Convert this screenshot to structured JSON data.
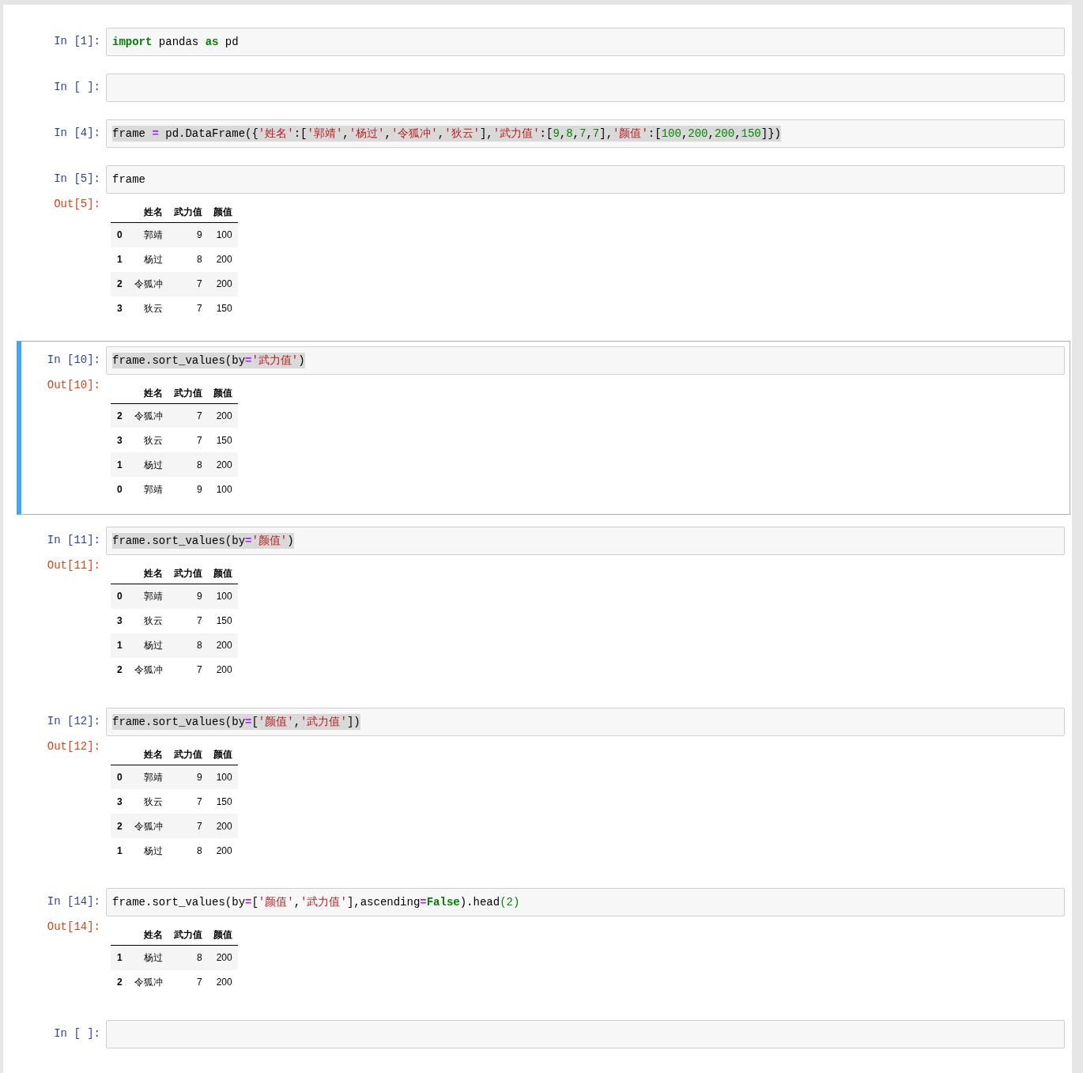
{
  "cells": [
    {
      "prompt": "In [1]:",
      "selected": false,
      "code": {
        "highlighted": false,
        "tokens": [
          {
            "kind": "keyword",
            "text": "import"
          },
          {
            "kind": "plain",
            "text": " pandas "
          },
          {
            "kind": "keyword",
            "text": "as"
          },
          {
            "kind": "plain",
            "text": " pd"
          }
        ]
      }
    },
    {
      "prompt": "In [ ]:",
      "selected": false
    },
    {
      "prompt": "In [4]:",
      "selected": false,
      "code": {
        "highlighted": true,
        "tokens": [
          {
            "kind": "plain",
            "text": "frame "
          },
          {
            "kind": "operator",
            "text": "="
          },
          {
            "kind": "plain",
            "text": " pd.DataFrame({"
          },
          {
            "kind": "string",
            "text": "'姓名'"
          },
          {
            "kind": "plain",
            "text": ":["
          },
          {
            "kind": "string",
            "text": "'郭靖'"
          },
          {
            "kind": "plain",
            "text": ","
          },
          {
            "kind": "string",
            "text": "'杨过'"
          },
          {
            "kind": "plain",
            "text": ","
          },
          {
            "kind": "string",
            "text": "'令狐冲'"
          },
          {
            "kind": "plain",
            "text": ","
          },
          {
            "kind": "string",
            "text": "'狄云'"
          },
          {
            "kind": "plain",
            "text": "],"
          },
          {
            "kind": "string",
            "text": "'武力值'"
          },
          {
            "kind": "plain",
            "text": ":["
          },
          {
            "kind": "number",
            "text": "9"
          },
          {
            "kind": "plain",
            "text": ","
          },
          {
            "kind": "number",
            "text": "8"
          },
          {
            "kind": "plain",
            "text": ","
          },
          {
            "kind": "number",
            "text": "7"
          },
          {
            "kind": "plain",
            "text": ","
          },
          {
            "kind": "number",
            "text": "7"
          },
          {
            "kind": "plain",
            "text": "],"
          },
          {
            "kind": "string",
            "text": "'颜值'"
          },
          {
            "kind": "plain",
            "text": ":["
          },
          {
            "kind": "number",
            "text": "100"
          },
          {
            "kind": "plain",
            "text": ","
          },
          {
            "kind": "number",
            "text": "200"
          },
          {
            "kind": "plain",
            "text": ","
          },
          {
            "kind": "number",
            "text": "200"
          },
          {
            "kind": "plain",
            "text": ","
          },
          {
            "kind": "number",
            "text": "150"
          },
          {
            "kind": "plain",
            "text": "]})"
          }
        ]
      }
    },
    {
      "prompt": "In [5]:",
      "selected": false,
      "code": {
        "highlighted": false,
        "tokens": [
          {
            "kind": "plain",
            "text": "frame"
          }
        ]
      },
      "output": {
        "prompt": "Out[5]:",
        "columns": [
          "姓名",
          "武力值",
          "颜值"
        ],
        "rows": [
          {
            "index": "0",
            "cells": [
              "郭靖",
              "9",
              "100"
            ]
          },
          {
            "index": "1",
            "cells": [
              "杨过",
              "8",
              "200"
            ]
          },
          {
            "index": "2",
            "cells": [
              "令狐冲",
              "7",
              "200"
            ]
          },
          {
            "index": "3",
            "cells": [
              "狄云",
              "7",
              "150"
            ]
          }
        ]
      }
    },
    {
      "prompt": "In [10]:",
      "selected": true,
      "code": {
        "highlighted": true,
        "tokens": [
          {
            "kind": "plain",
            "text": "frame.sort_values(by"
          },
          {
            "kind": "operator",
            "text": "="
          },
          {
            "kind": "string",
            "text": "'武力值'"
          },
          {
            "kind": "plain",
            "text": ")"
          }
        ]
      },
      "output": {
        "prompt": "Out[10]:",
        "columns": [
          "姓名",
          "武力值",
          "颜值"
        ],
        "rows": [
          {
            "index": "2",
            "cells": [
              "令狐冲",
              "7",
              "200"
            ]
          },
          {
            "index": "3",
            "cells": [
              "狄云",
              "7",
              "150"
            ]
          },
          {
            "index": "1",
            "cells": [
              "杨过",
              "8",
              "200"
            ]
          },
          {
            "index": "0",
            "cells": [
              "郭靖",
              "9",
              "100"
            ]
          }
        ]
      }
    },
    {
      "prompt": "In [11]:",
      "selected": false,
      "code": {
        "highlighted": true,
        "tokens": [
          {
            "kind": "plain",
            "text": "frame.sort_values(by"
          },
          {
            "kind": "operator",
            "text": "="
          },
          {
            "kind": "string",
            "text": "'颜值'"
          },
          {
            "kind": "plain",
            "text": ")"
          }
        ]
      },
      "output": {
        "prompt": "Out[11]:",
        "columns": [
          "姓名",
          "武力值",
          "颜值"
        ],
        "rows": [
          {
            "index": "0",
            "cells": [
              "郭靖",
              "9",
              "100"
            ]
          },
          {
            "index": "3",
            "cells": [
              "狄云",
              "7",
              "150"
            ]
          },
          {
            "index": "1",
            "cells": [
              "杨过",
              "8",
              "200"
            ]
          },
          {
            "index": "2",
            "cells": [
              "令狐冲",
              "7",
              "200"
            ]
          }
        ]
      }
    },
    {
      "prompt": "In [12]:",
      "selected": false,
      "code": {
        "highlighted": true,
        "tokens": [
          {
            "kind": "plain",
            "text": "frame.sort_values(by"
          },
          {
            "kind": "operator",
            "text": "="
          },
          {
            "kind": "plain",
            "text": "["
          },
          {
            "kind": "string",
            "text": "'颜值'"
          },
          {
            "kind": "plain",
            "text": ","
          },
          {
            "kind": "string",
            "text": "'武力值'"
          },
          {
            "kind": "plain",
            "text": "])"
          }
        ]
      },
      "output": {
        "prompt": "Out[12]:",
        "columns": [
          "姓名",
          "武力值",
          "颜值"
        ],
        "rows": [
          {
            "index": "0",
            "cells": [
              "郭靖",
              "9",
              "100"
            ]
          },
          {
            "index": "3",
            "cells": [
              "狄云",
              "7",
              "150"
            ]
          },
          {
            "index": "2",
            "cells": [
              "令狐冲",
              "7",
              "200"
            ]
          },
          {
            "index": "1",
            "cells": [
              "杨过",
              "8",
              "200"
            ]
          }
        ]
      }
    },
    {
      "prompt": "In [14]:",
      "selected": false,
      "code": {
        "highlighted": false,
        "tokens": [
          {
            "kind": "plain",
            "text": "frame.sort_values(by"
          },
          {
            "kind": "operator",
            "text": "="
          },
          {
            "kind": "plain",
            "text": "["
          },
          {
            "kind": "string",
            "text": "'颜值'"
          },
          {
            "kind": "plain",
            "text": ","
          },
          {
            "kind": "string",
            "text": "'武力值'"
          },
          {
            "kind": "plain",
            "text": "],ascending"
          },
          {
            "kind": "operator",
            "text": "="
          },
          {
            "kind": "keyword",
            "text": "False"
          },
          {
            "kind": "plain",
            "text": ").head"
          },
          {
            "kind": "number",
            "text": "(2)"
          }
        ]
      },
      "output": {
        "prompt": "Out[14]:",
        "columns": [
          "姓名",
          "武力值",
          "颜值"
        ],
        "rows": [
          {
            "index": "1",
            "cells": [
              "杨过",
              "8",
              "200"
            ]
          },
          {
            "index": "2",
            "cells": [
              "令狐冲",
              "7",
              "200"
            ]
          }
        ]
      }
    },
    {
      "prompt": "In [ ]:",
      "selected": false
    }
  ]
}
